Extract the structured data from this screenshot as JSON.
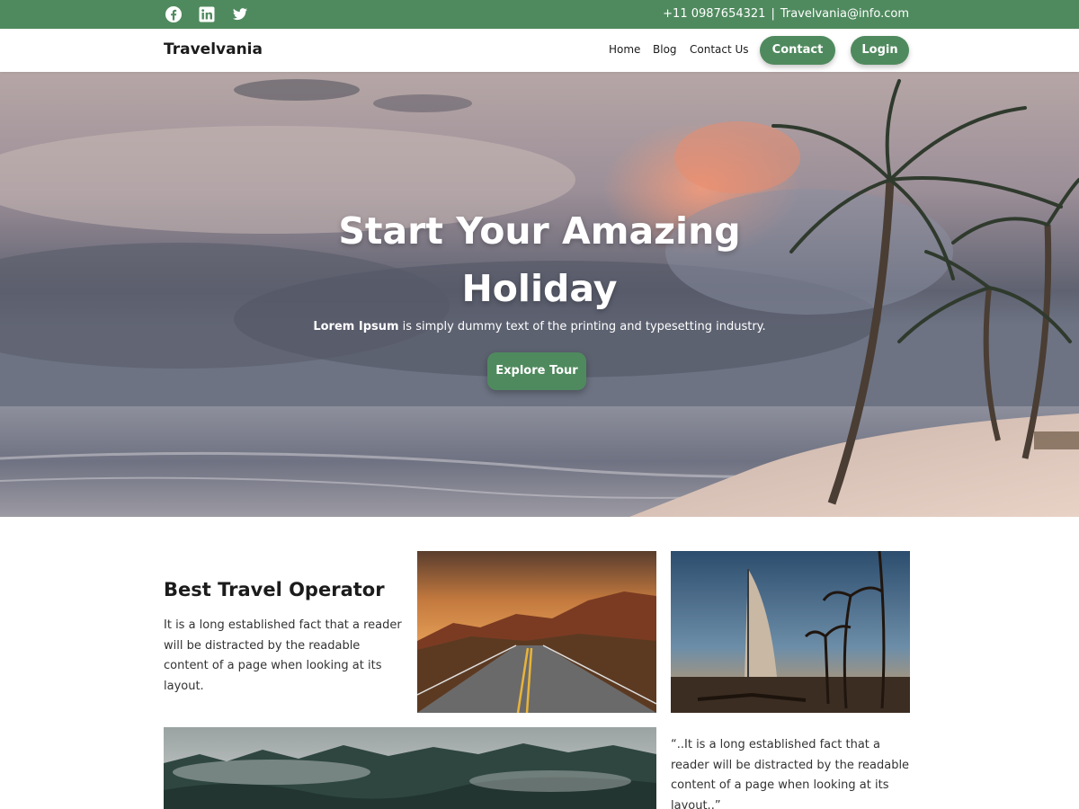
{
  "topbar": {
    "social": [
      {
        "name": "facebook",
        "icon": "facebook-icon"
      },
      {
        "name": "linkedin",
        "icon": "linkedin-icon"
      },
      {
        "name": "twitter",
        "icon": "twitter-icon"
      }
    ],
    "phone": "+11 0987654321",
    "separator": "|",
    "email": "Travelvania@info.com"
  },
  "nav": {
    "brand": "Travelvania",
    "links": [
      "Home",
      "Blog",
      "Contact Us"
    ],
    "contact_button": "Contact",
    "login_button": "Login"
  },
  "hero": {
    "title": "Start Your Amazing Holiday",
    "subtitle_bold": "Lorem Ipsum",
    "subtitle_rest": " is simply dummy text of the printing and typesetting industry.",
    "button": "Explore Tour"
  },
  "about": {
    "title": "Best Travel Operator",
    "text": "It is a long established fact that a reader will be distracted by the readable content of a page when looking at its layout.",
    "quote": "“..It is a long established fact that a reader will be distracted by the readable content of a page when looking at its layout..”"
  },
  "colors": {
    "accent": "#4f8a5e",
    "text": "#1b1b1b",
    "white": "#ffffff"
  }
}
